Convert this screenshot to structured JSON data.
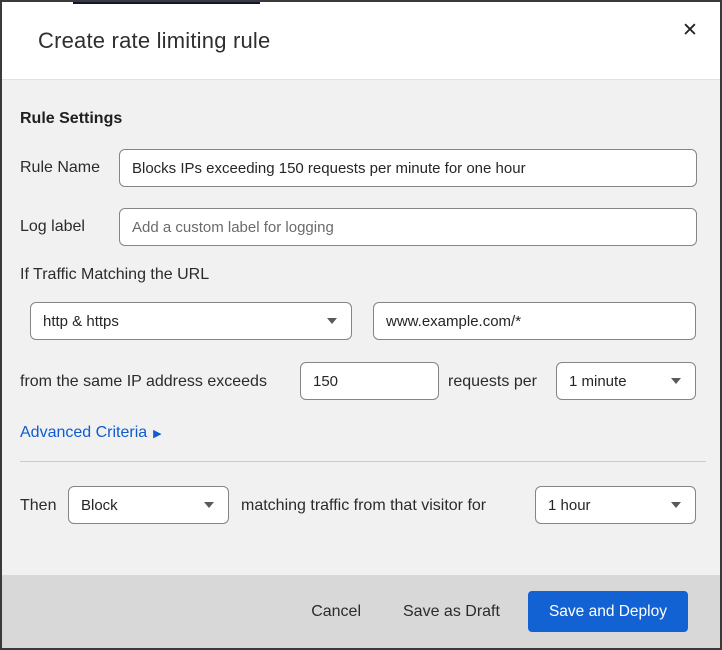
{
  "dialog": {
    "title": "Create rate limiting rule",
    "close_icon": "✕"
  },
  "rule_settings": {
    "heading": "Rule Settings",
    "rule_name": {
      "label": "Rule Name",
      "value": "Blocks IPs exceeding 150 requests per minute for one hour"
    },
    "log_label": {
      "label": "Log label",
      "placeholder": "Add a custom label for logging"
    }
  },
  "traffic_match": {
    "heading": "If Traffic Matching the URL",
    "scheme_select": {
      "value": "http & https"
    },
    "url_input": {
      "value": "www.example.com/*"
    },
    "threshold": {
      "prefix": "from the same IP address exceeds",
      "count_value": "150",
      "middle": "requests per",
      "period_select": {
        "value": "1 minute"
      }
    },
    "advanced_criteria": {
      "label": "Advanced Criteria",
      "arrow": "▶"
    }
  },
  "action": {
    "then_label": "Then",
    "action_select": {
      "value": "Block"
    },
    "middle": "matching traffic from that visitor for",
    "duration_select": {
      "value": "1 hour"
    }
  },
  "footer": {
    "cancel": "Cancel",
    "save_draft": "Save as Draft",
    "save_deploy": "Save and Deploy"
  },
  "colors": {
    "primary_blue": "#1262d3",
    "link_blue": "#0f5bd0",
    "body_bg": "#f1f1f1",
    "footer_bg": "#d8d8d8",
    "border_dark": "#3a3a3a",
    "top_strip_navy": "#0d1733"
  }
}
